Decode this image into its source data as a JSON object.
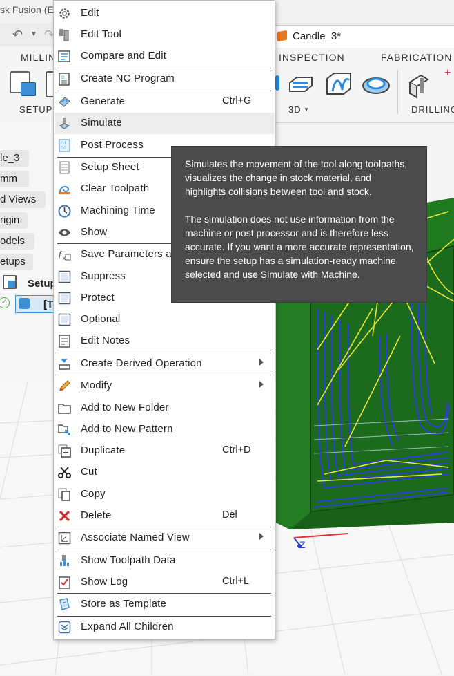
{
  "app": {
    "title_fragment": "sk Fusion (E"
  },
  "document": {
    "tab_name": "Candle_3*"
  },
  "ribbon": {
    "tabs": [
      "MILLIN",
      "INSPECTION",
      "FABRICATION"
    ],
    "groups": {
      "setup": "SETUP",
      "3d": "3D",
      "drilling": "DRILLING"
    }
  },
  "browser": {
    "items": [
      "le_3",
      "mm",
      "d Views",
      "rigin",
      "odels",
      "etups"
    ],
    "setup_label": "Setup",
    "toolpath_label": "[T"
  },
  "viewport": {
    "axis_label": "Z",
    "stock_color": "#1d6e1d",
    "toolpath_color": "#2a3fd8",
    "rapid_color": "#e8e838"
  },
  "context_menu": {
    "items": [
      {
        "label": "Edit",
        "icon": "gear-icon"
      },
      {
        "label": "Edit Tool",
        "icon": "tool-icon"
      },
      {
        "label": "Compare and Edit",
        "icon": "compare-icon"
      },
      {
        "label": "Create NC Program",
        "icon": "nc-program-icon"
      },
      {
        "label": "Generate",
        "shortcut": "Ctrl+G",
        "icon": "generate-icon"
      },
      {
        "label": "Simulate",
        "icon": "simulate-icon"
      },
      {
        "label": "Post Process",
        "icon": "post-process-icon"
      },
      {
        "label": "Setup Sheet",
        "icon": "setup-sheet-icon"
      },
      {
        "label": "Clear Toolpath",
        "icon": "clear-toolpath-icon"
      },
      {
        "label": "Machining Time",
        "icon": "clock-icon"
      },
      {
        "label": "Show",
        "icon": "eye-icon"
      },
      {
        "label": "Save Parameters as",
        "icon": "function-icon"
      },
      {
        "label": "Suppress",
        "icon": "checkbox-icon"
      },
      {
        "label": "Protect",
        "icon": "checkbox-icon"
      },
      {
        "label": "Optional",
        "icon": "checkbox-icon"
      },
      {
        "label": "Edit Notes",
        "icon": "notes-icon"
      },
      {
        "label": "Create Derived Operation",
        "icon": "derived-icon",
        "submenu": true
      },
      {
        "label": "Modify",
        "icon": "pencil-icon",
        "submenu": true
      },
      {
        "label": "Add to New Folder",
        "icon": "folder-icon"
      },
      {
        "label": "Add to New Pattern",
        "icon": "pattern-icon"
      },
      {
        "label": "Duplicate",
        "shortcut": "Ctrl+D",
        "icon": "duplicate-icon"
      },
      {
        "label": "Cut",
        "icon": "scissors-icon"
      },
      {
        "label": "Copy",
        "icon": "copy-icon"
      },
      {
        "label": "Delete",
        "shortcut": "Del",
        "icon": "delete-icon"
      },
      {
        "label": "Associate Named View",
        "icon": "named-view-icon",
        "submenu": true
      },
      {
        "label": "Show Toolpath Data",
        "icon": "toolpath-data-icon"
      },
      {
        "label": "Show Log",
        "shortcut": "Ctrl+L",
        "icon": "log-icon"
      },
      {
        "label": "Store as Template",
        "icon": "template-icon"
      },
      {
        "label": "Expand All Children",
        "icon": "expand-icon"
      }
    ]
  },
  "tooltip": {
    "paragraph1": "Simulates the movement of the tool along toolpaths, visualizes the change in stock material, and highlights collisions between tool and stock.",
    "paragraph2": "The simulation does not use information from the machine or post processor and is therefore less accurate. If you want a more accurate representation, ensure the setup has a simulation-ready machine selected and use Simulate with Machine."
  }
}
